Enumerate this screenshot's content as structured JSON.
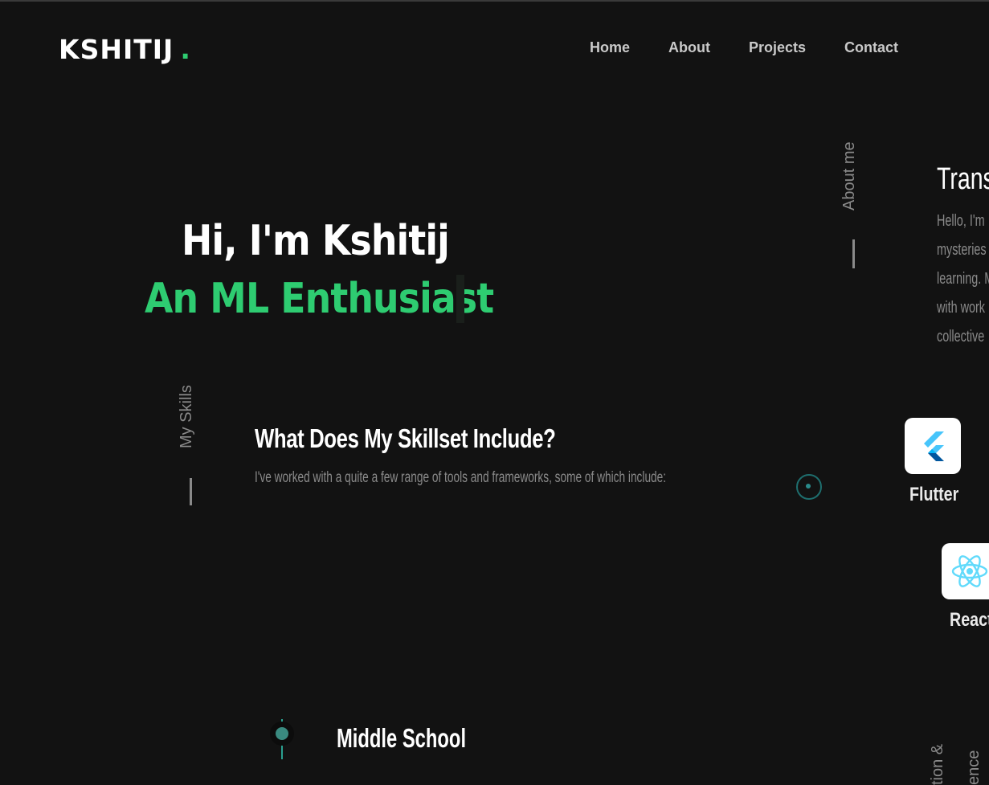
{
  "header": {
    "logo_text": "KSHITIJ",
    "logo_dot": ".",
    "nav": [
      "Home",
      "About",
      "Projects",
      "Contact"
    ]
  },
  "hero": {
    "greeting": "Hi, I'm Kshitij",
    "tagline": "An ML Enthusiast"
  },
  "about": {
    "side_label": "About me",
    "title": "Trans",
    "lines": [
      "Hello, I'm",
      "mysteries",
      "learning. M",
      "with work",
      "collective"
    ]
  },
  "skills": {
    "side_label": "My Skills",
    "title": "What Does My Skillset Include?",
    "description": "I've worked with a quite a few range of tools and frameworks, some of which include:",
    "items": [
      {
        "name": "Flutter",
        "icon": "flutter-icon"
      },
      {
        "name": "React",
        "icon": "react-icon"
      }
    ]
  },
  "education": {
    "side_label_1": "tion &",
    "side_label_2": "ence",
    "entry_title": "Middle School"
  },
  "colors": {
    "accent": "#2ecc71",
    "bg": "#121212"
  }
}
